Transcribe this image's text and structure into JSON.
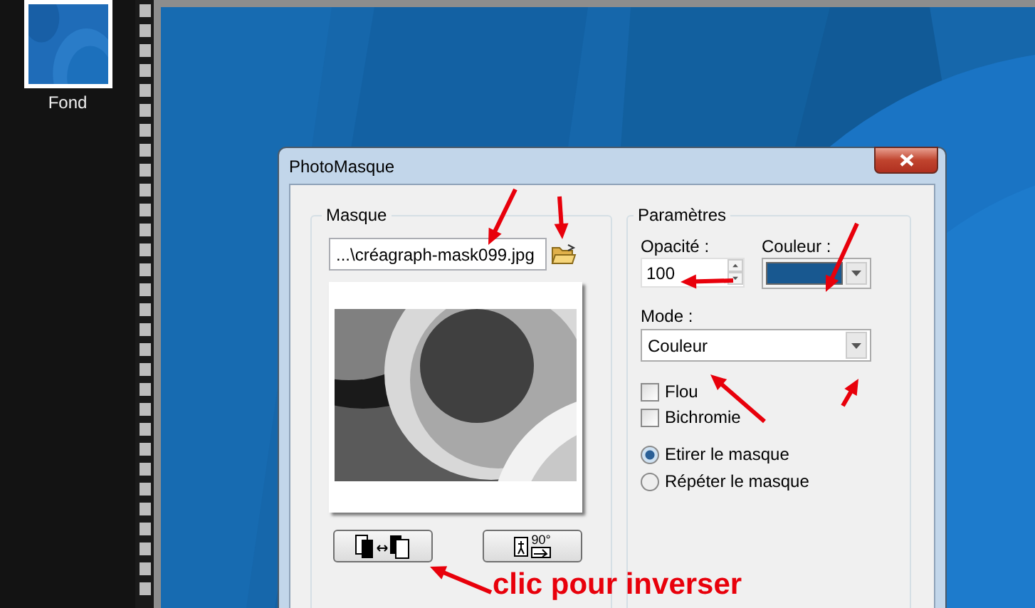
{
  "layers": [
    {
      "label": "Fond",
      "selected": true
    }
  ],
  "dialog": {
    "title": "PhotoMasque",
    "mask": {
      "heading": "Masque",
      "file": "...\\créagraph-mask099.jpg",
      "rotate_label": "90°"
    },
    "params": {
      "heading": "Paramètres",
      "opacity_label": "Opacité :",
      "opacity": "100",
      "color_label": "Couleur :",
      "color": "#185890",
      "mode_label": "Mode :",
      "mode": "Couleur",
      "options": [
        {
          "label": "Flou",
          "checked": false
        },
        {
          "label": "Bichromie",
          "checked": false
        }
      ],
      "fill_modes": [
        {
          "label": "Etirer le masque",
          "selected": true
        },
        {
          "label": "Répéter le masque",
          "selected": false
        }
      ]
    }
  },
  "annotation": "clic pour inverser"
}
